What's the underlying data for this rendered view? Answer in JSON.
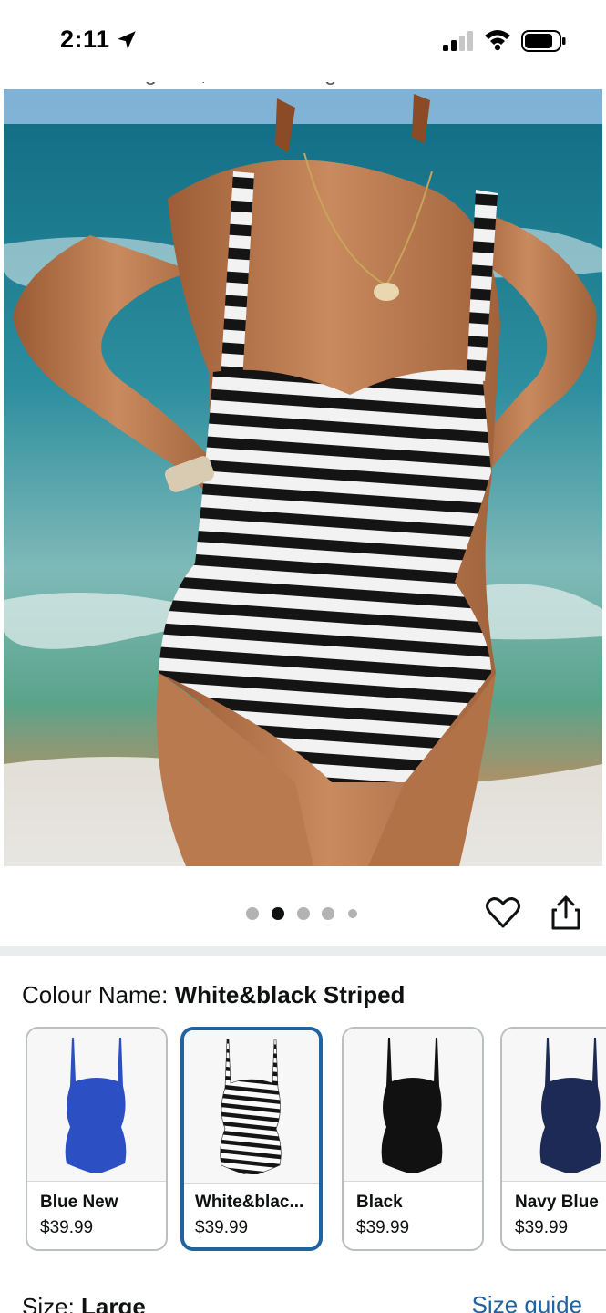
{
  "status_bar": {
    "time": "2:11"
  },
  "product": {
    "title_fragment": "Piece Bathing Suit, Full Coverage"
  },
  "gallery": {
    "image_count": 5,
    "active_index": 1
  },
  "colour": {
    "label": "Colour Name: ",
    "selected": "White&black Striped",
    "options": [
      {
        "name": "Blue New",
        "price": "$39.99",
        "color": "#2d4fc4"
      },
      {
        "name": "White&blac...",
        "price": "$39.99",
        "color": "#ffffff"
      },
      {
        "name": "Black",
        "price": "$39.99",
        "color": "#111111"
      },
      {
        "name": "Navy Blue",
        "price": "$39.99",
        "color": "#1d2a55"
      }
    ]
  },
  "size": {
    "label": "Size: ",
    "selected": "Large",
    "guide_link": "Size guide"
  },
  "accent_color": "#2162a1"
}
